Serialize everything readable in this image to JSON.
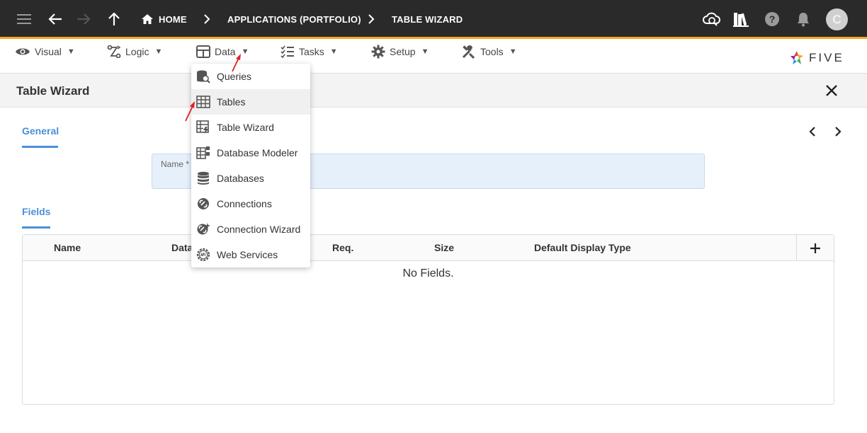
{
  "topbar": {
    "breadcrumbs": [
      "HOME",
      "APPLICATIONS (PORTFOLIO)",
      "TABLE WIZARD"
    ],
    "avatar_letter": "C"
  },
  "menubar": {
    "items": [
      {
        "label": "Visual",
        "icon": "eye-icon"
      },
      {
        "label": "Logic",
        "icon": "logic-icon"
      },
      {
        "label": "Data",
        "icon": "table-grid-icon"
      },
      {
        "label": "Tasks",
        "icon": "checklist-icon"
      },
      {
        "label": "Setup",
        "icon": "gear-icon"
      },
      {
        "label": "Tools",
        "icon": "tools-icon"
      }
    ],
    "caret": "▼",
    "logo_text": "FIVE"
  },
  "page": {
    "title": "Table Wizard",
    "tabs": {
      "general": "General",
      "fields": "Fields"
    },
    "name_field_label": "Name *",
    "table_headers": [
      "Name",
      "Data",
      "Req.",
      "Size",
      "Default Display Type"
    ],
    "empty_message": "No Fields."
  },
  "data_menu": {
    "items": [
      {
        "label": "Queries",
        "icon": "query-db-icon"
      },
      {
        "label": "Tables",
        "icon": "table-icon"
      },
      {
        "label": "Table Wizard",
        "icon": "table-wizard-icon"
      },
      {
        "label": "Database Modeler",
        "icon": "database-modeler-icon"
      },
      {
        "label": "Databases",
        "icon": "database-icon"
      },
      {
        "label": "Connections",
        "icon": "connections-icon"
      },
      {
        "label": "Connection Wizard",
        "icon": "connection-wizard-icon"
      },
      {
        "label": "Web Services",
        "icon": "web-services-icon"
      }
    ],
    "hovered_index": 1
  },
  "colors": {
    "topbar_bg": "#2a2a2a",
    "accent_orange": "#f5a623",
    "tab_blue": "#4a90d9",
    "annotation_red": "#e02020"
  }
}
